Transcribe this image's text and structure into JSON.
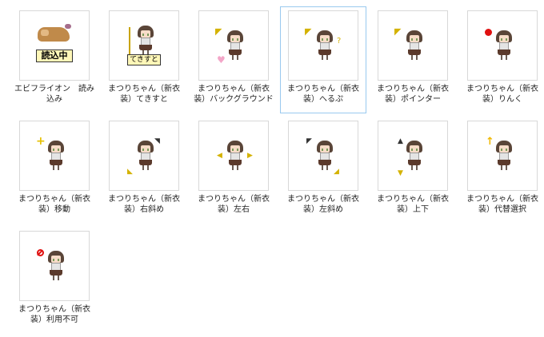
{
  "items": [
    {
      "label": "エビフライオン　読み込み",
      "icon": "ebi-fry-loading-icon",
      "badge": "読込中"
    },
    {
      "label": "まつりちゃん（新衣装）てきすと",
      "icon": "text-cursor-icon",
      "badge": "てきすと"
    },
    {
      "label": "まつりちゃん（新衣装）バックグラウンド",
      "icon": "background-cursor-icon"
    },
    {
      "label": "まつりちゃん（新衣装）へるぷ",
      "icon": "help-cursor-icon",
      "selected": true
    },
    {
      "label": "まつりちゃん（新衣装）ポインター",
      "icon": "pointer-cursor-icon"
    },
    {
      "label": "まつりちゃん（新衣装）りんく",
      "icon": "link-cursor-icon"
    },
    {
      "label": "まつりちゃん（新衣装）移動",
      "icon": "move-cursor-icon"
    },
    {
      "label": "まつりちゃん（新衣装）右斜め",
      "icon": "diagonal-right-cursor-icon"
    },
    {
      "label": "まつりちゃん（新衣装）左右",
      "icon": "horizontal-cursor-icon"
    },
    {
      "label": "まつりちゃん（新衣装）左斜め",
      "icon": "diagonal-left-cursor-icon"
    },
    {
      "label": "まつりちゃん（新衣装）上下",
      "icon": "vertical-cursor-icon"
    },
    {
      "label": "まつりちゃん（新衣装）代替選択",
      "icon": "alternate-select-cursor-icon"
    },
    {
      "label": "まつりちゃん（新衣装）利用不可",
      "icon": "unavailable-cursor-icon"
    }
  ],
  "colors": {
    "selection_border": "#99c9ef",
    "thumb_border": "#d8d8d8"
  }
}
